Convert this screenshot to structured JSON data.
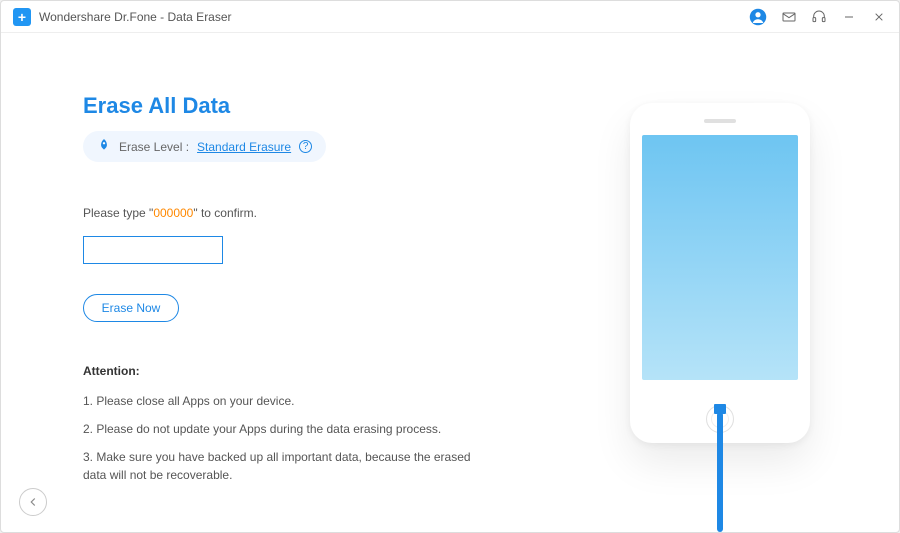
{
  "header": {
    "app_title": "Wondershare Dr.Fone - Data Eraser"
  },
  "main": {
    "title": "Erase All Data",
    "erase_level_label": "Erase Level :",
    "erase_level_value": "Standard Erasure",
    "help_symbol": "?",
    "confirm_prefix": "Please type \"",
    "confirm_code": "000000",
    "confirm_suffix": "\" to confirm.",
    "confirm_input_value": "",
    "erase_button": "Erase Now",
    "attention_title": "Attention:",
    "attention_items": [
      "1. Please close all Apps on your device.",
      "2. Please do not update your Apps during the data erasing process.",
      "3. Make sure you have backed up all important data, because the erased data will not be recoverable."
    ]
  },
  "colors": {
    "accent": "#1e88e5",
    "warn": "#ff8800"
  }
}
